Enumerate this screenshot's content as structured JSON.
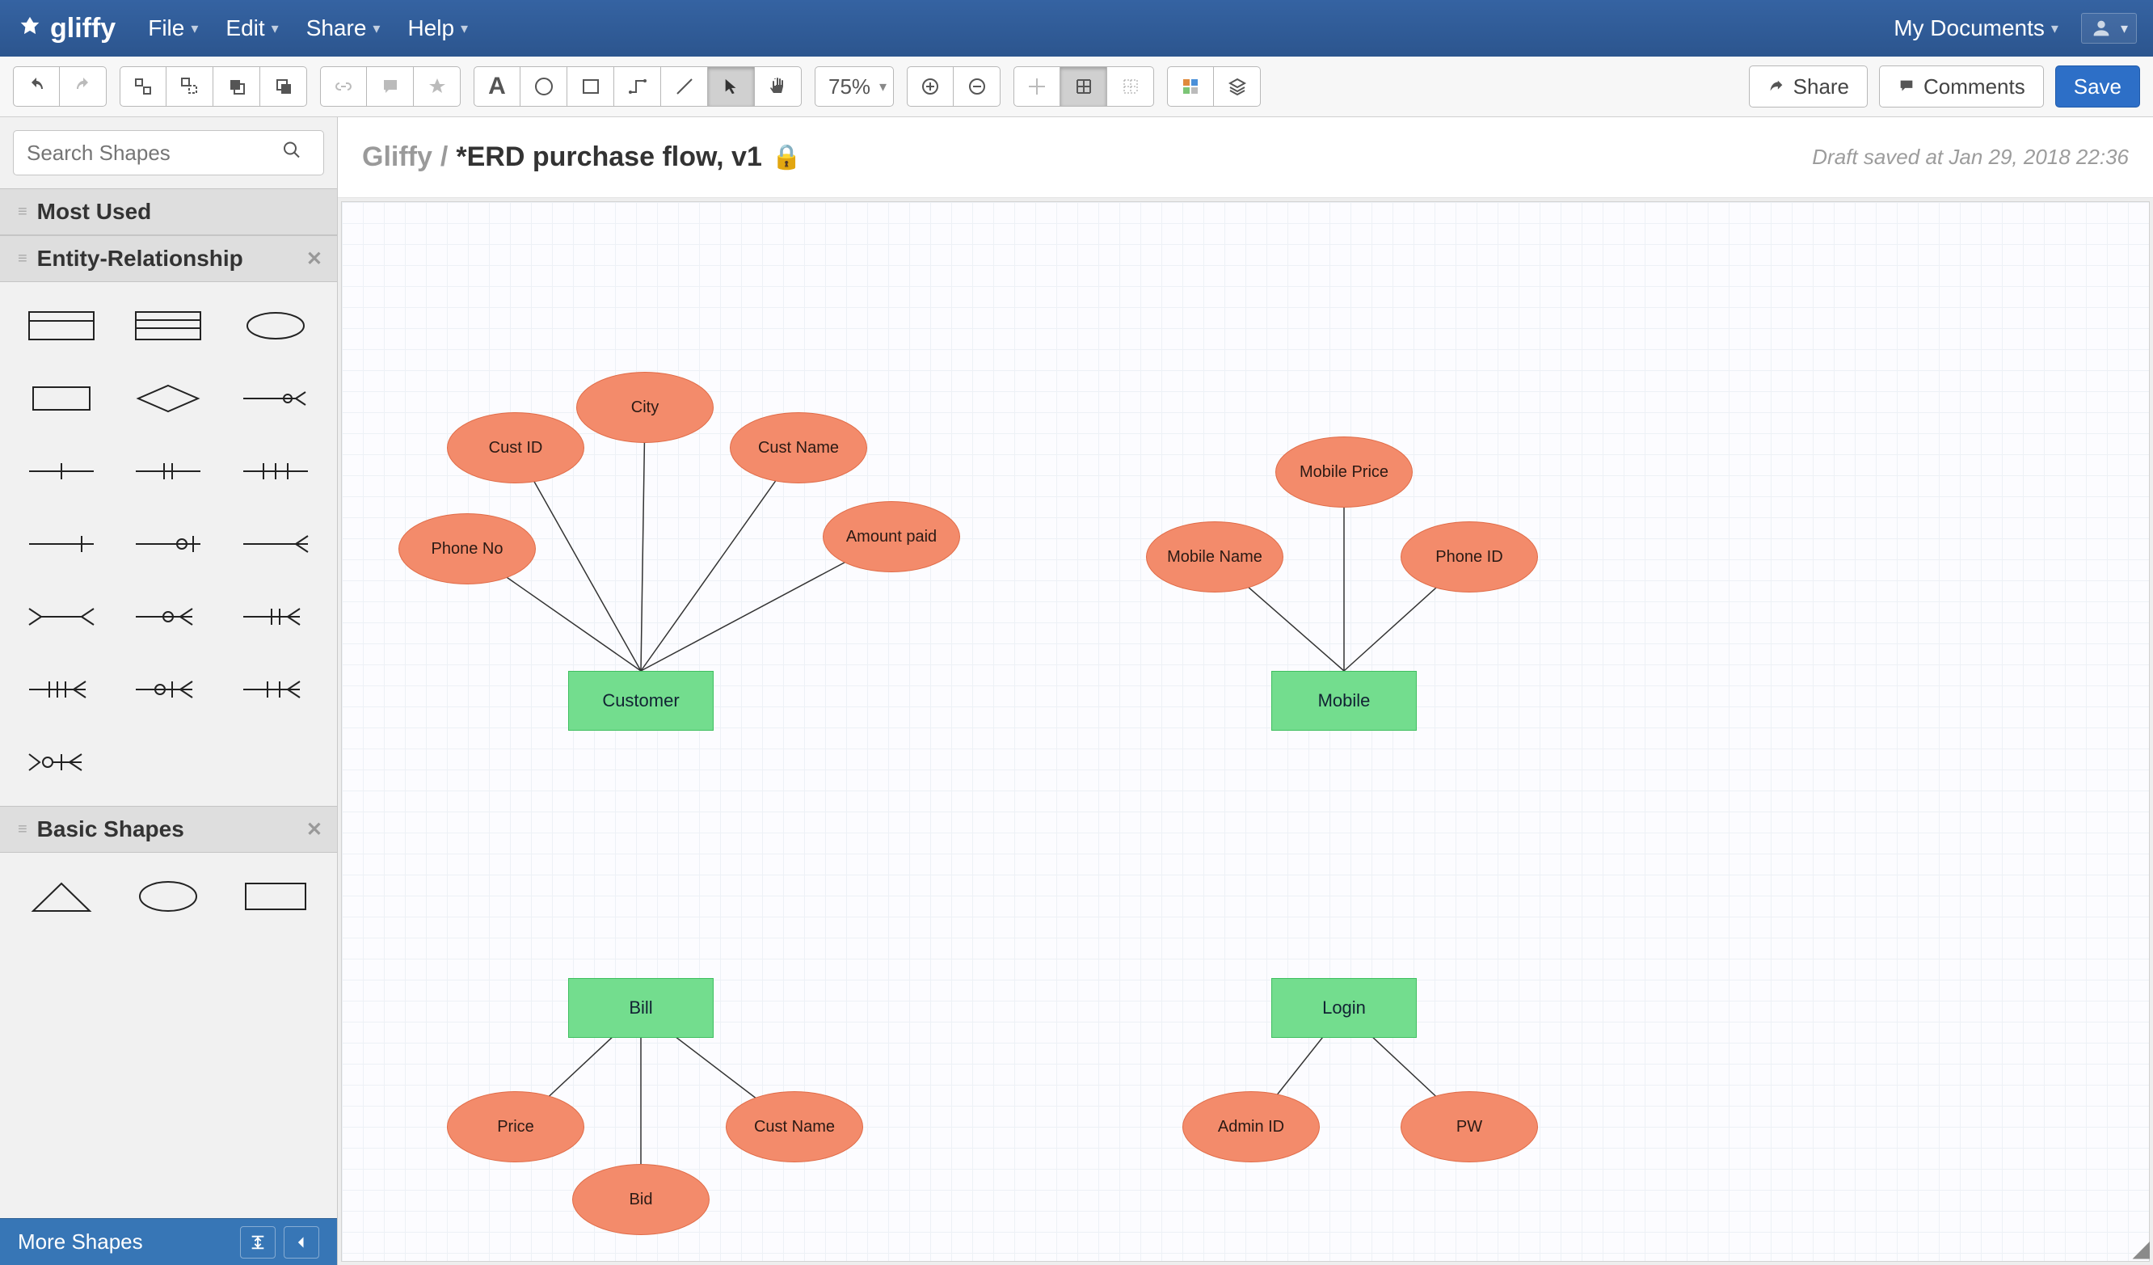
{
  "app": {
    "brand": "gliffy"
  },
  "menubar": {
    "file": "File",
    "edit": "Edit",
    "share": "Share",
    "help": "Help",
    "mydocs": "My Documents"
  },
  "toolbar": {
    "zoom": "75%",
    "share": "Share",
    "comments": "Comments",
    "save": "Save"
  },
  "sidebar": {
    "search_placeholder": "Search Shapes",
    "sections": {
      "most_used": "Most Used",
      "er": "Entity-Relationship",
      "basic": "Basic Shapes"
    },
    "footer": {
      "more": "More Shapes"
    }
  },
  "doc": {
    "crumb": "Gliffy",
    "title": "*ERD purchase flow, v1",
    "draft": "Draft saved at Jan 29, 2018 22:36"
  },
  "diagram": {
    "entities": {
      "customer": "Customer",
      "mobile": "Mobile",
      "bill": "Bill",
      "login": "Login"
    },
    "attributes": {
      "phone_no": "Phone No",
      "cust_id": "Cust ID",
      "city": "City",
      "cust_name_1": "Cust Name",
      "amount_paid": "Amount paid",
      "mobile_name": "Mobile Name",
      "mobile_price": "Mobile Price",
      "phone_id": "Phone ID",
      "price": "Price",
      "bid": "Bid",
      "cust_name_2": "Cust Name",
      "admin_id": "Admin ID",
      "pw": "PW"
    }
  }
}
